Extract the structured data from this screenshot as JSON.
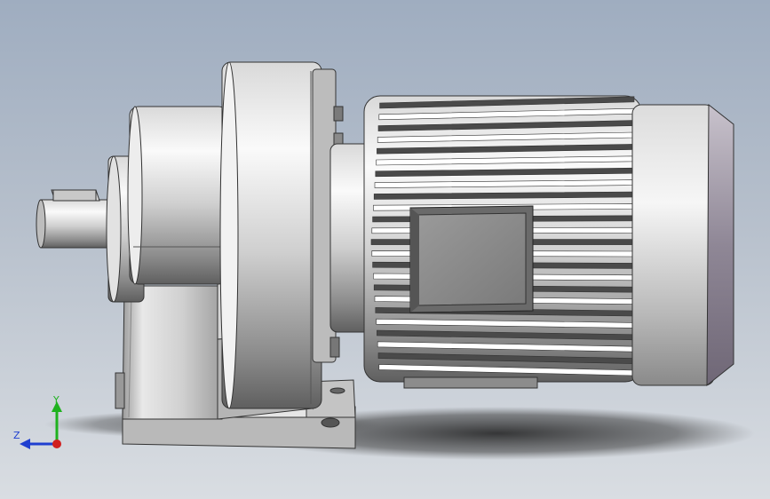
{
  "triad": {
    "y_label": "Y",
    "z_label": "Z",
    "y_color": "#1fb21f",
    "z_color": "#1f3fd0",
    "x_color": "#d01f1f"
  },
  "colors": {
    "background_top": "#9fadc0",
    "background_bottom": "#d9dde2",
    "metal_light": "#f4f4f4",
    "metal_mid": "#c8c8c8",
    "metal_dark": "#6e6e6e"
  }
}
